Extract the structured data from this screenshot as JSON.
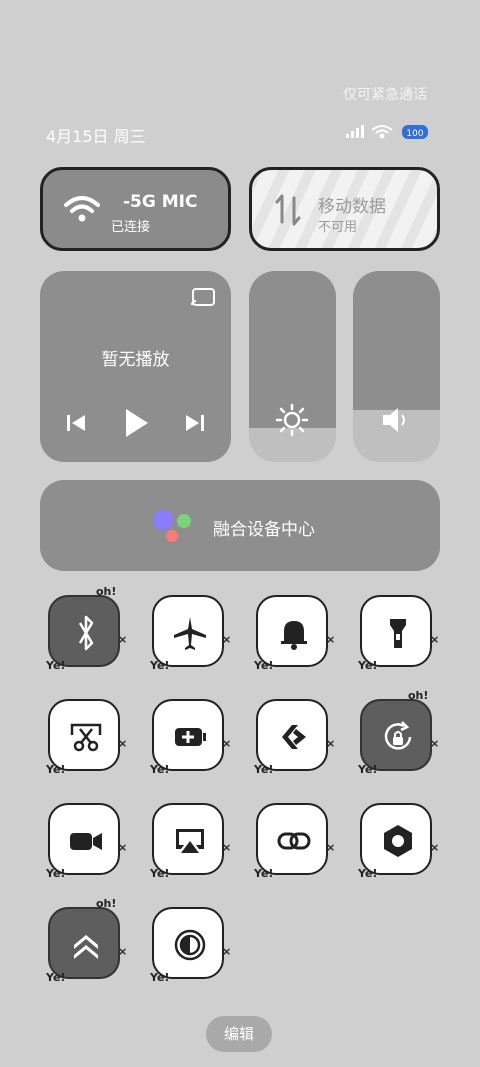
{
  "status": {
    "emergency_note": "仅可紧急通话",
    "date": "4月15日 周三",
    "battery": "100"
  },
  "wifi": {
    "title": "-5G MIC",
    "sub": "已连接"
  },
  "mobile_data": {
    "title": "移动数据",
    "sub": "不可用"
  },
  "media": {
    "label": "暂无播放"
  },
  "brightness": {
    "level": 0.18
  },
  "volume": {
    "level": 0.27
  },
  "fusion": {
    "label": "融合设备中心"
  },
  "toggles": [
    {
      "name": "bluetooth",
      "on": true
    },
    {
      "name": "airplane",
      "on": false
    },
    {
      "name": "bell",
      "on": false
    },
    {
      "name": "flashlight",
      "on": false
    },
    {
      "name": "screenshot",
      "on": false
    },
    {
      "name": "battery-saver",
      "on": false
    },
    {
      "name": "link",
      "on": false
    },
    {
      "name": "rotation-lock",
      "on": true
    },
    {
      "name": "video",
      "on": false
    },
    {
      "name": "screen-cast",
      "on": false
    },
    {
      "name": "chain",
      "on": false
    },
    {
      "name": "nut",
      "on": false
    },
    {
      "name": "boost",
      "on": true
    },
    {
      "name": "contrast",
      "on": false
    }
  ],
  "edit": {
    "label": "编辑"
  },
  "colors": {
    "tile_on": "#5e5e5e",
    "tile_off": "#ffffff",
    "panel": "#8e8e8e"
  }
}
